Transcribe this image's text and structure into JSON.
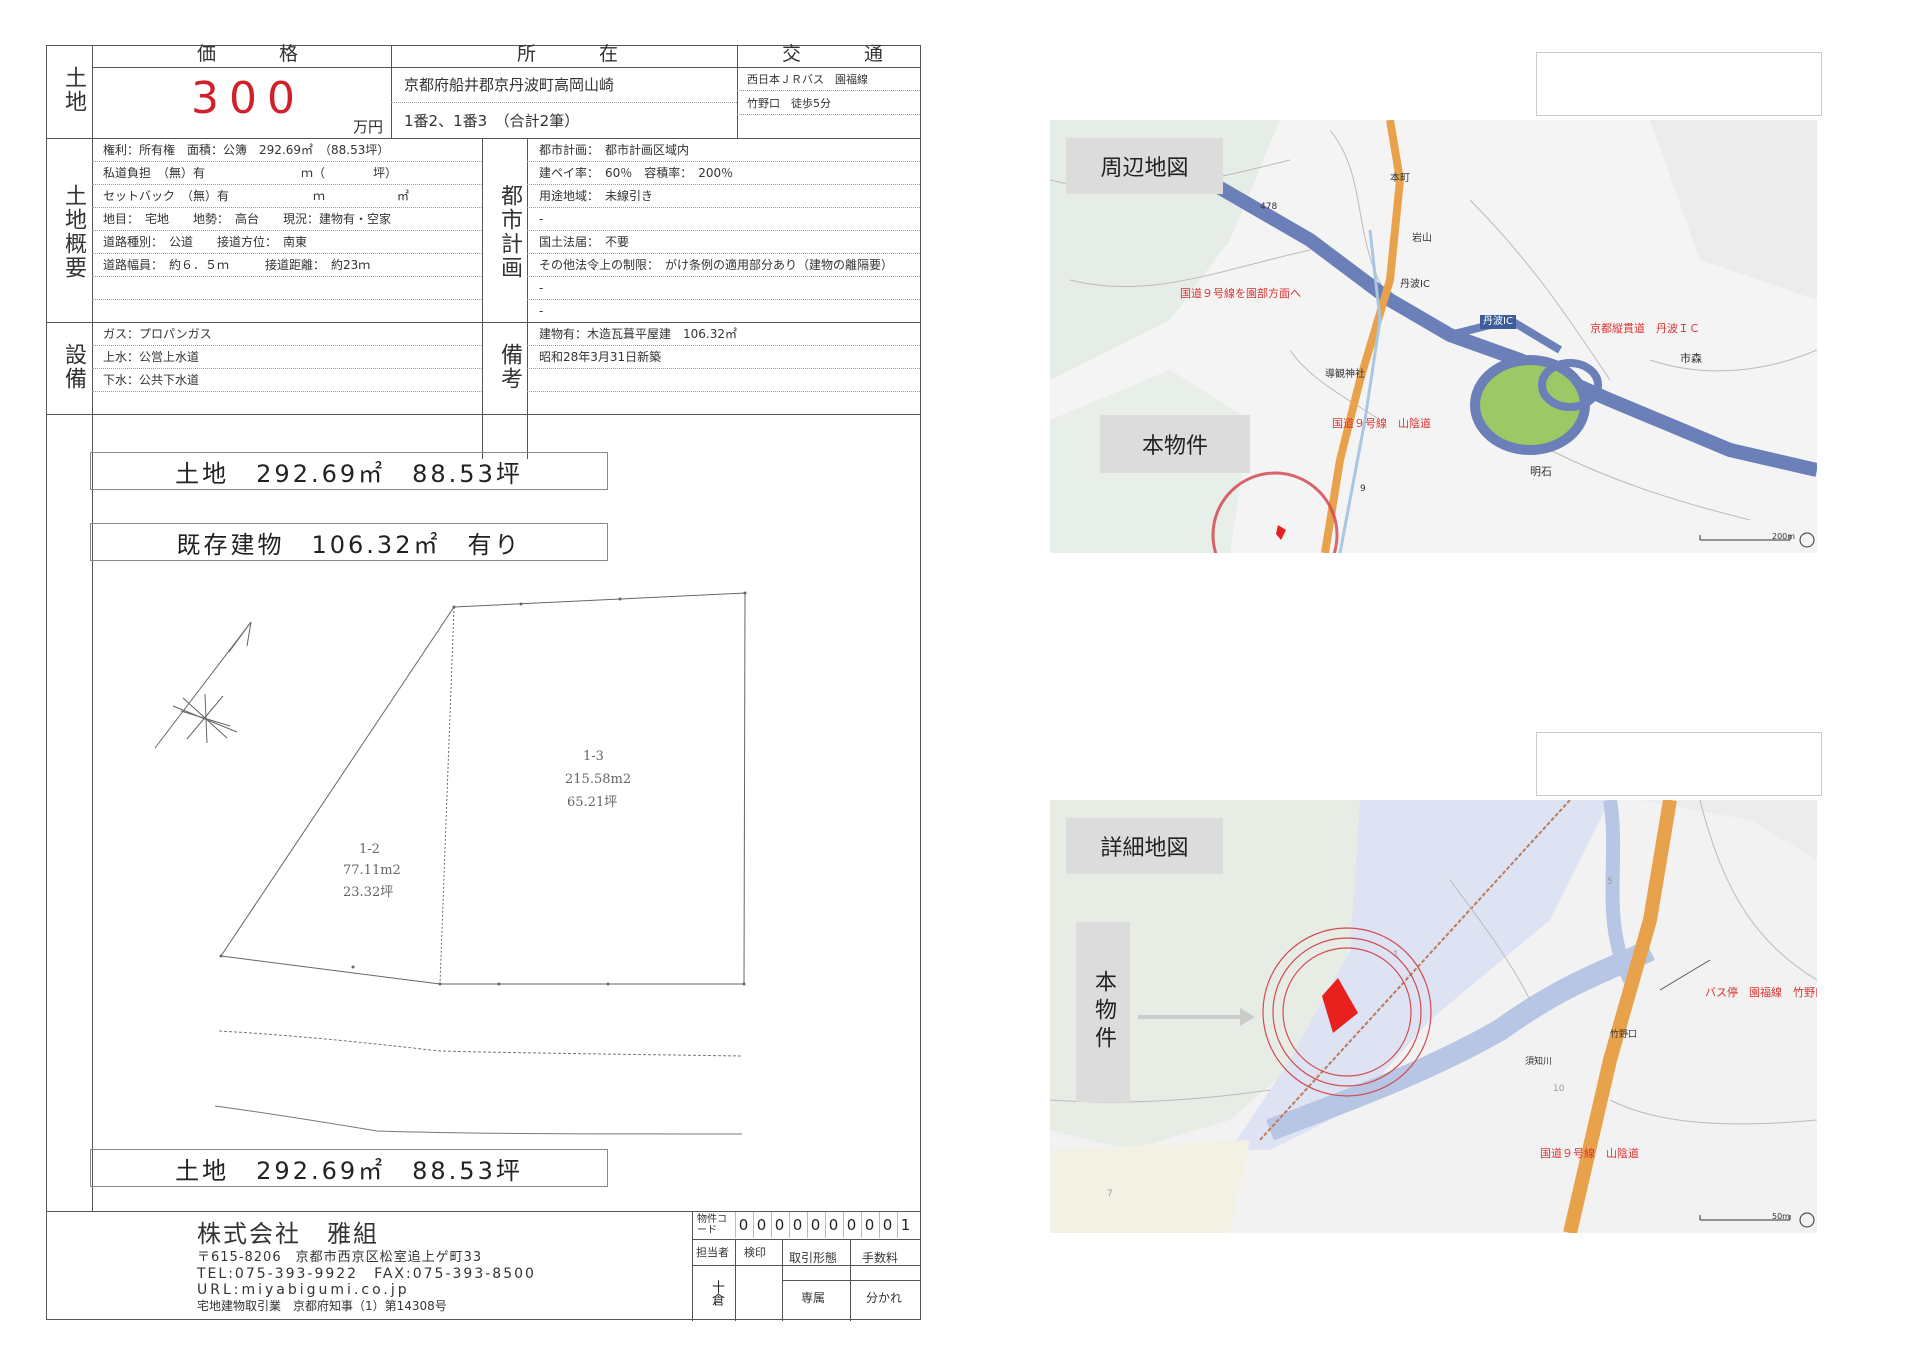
{
  "header": {
    "category_label": "土地",
    "price_header": "価　格",
    "location_header": "所　在",
    "transport_header": "交　通",
    "price_value": "300",
    "price_unit": "万円",
    "address_line1": "京都府船井郡京丹波町高岡山崎",
    "address_line2": "1番2、1番3　（合計2筆）",
    "transport_line1": "西日本ＪＲバス　園福線",
    "transport_line2": "竹野口　徒歩5分"
  },
  "land_overview": {
    "section_label": "土地概要",
    "rows": [
      "権利：所有権　面積：公簿　292.69㎡　（88.53坪）",
      "私道負担　（無）有　　　　　　　　ｍ（　　　　坪）",
      "セットバック　（無）有　　　　　　　ｍ　　　　　　㎡",
      "地目：　宅地　　地勢：　高台　　現況：建物有・空家",
      "道路種別：　公道　　接道方位：　南東",
      "道路幅員：　約６．５ｍ　　　接道距離：　約23ｍ"
    ]
  },
  "city_planning": {
    "section_label": "都市計画",
    "rows": [
      "都市計画：　都市計画区域内",
      "建ペイ率：　60％　容積率：　200％",
      "用途地域：　未線引き",
      "-",
      "国土法届：　不要",
      "その他法令上の制限：　がけ条例の適用部分あり（建物の離隔要）",
      "-",
      "-"
    ]
  },
  "facilities": {
    "section_label": "設備",
    "rows": [
      "ガス：プロパンガス",
      "上水：公営上水道",
      "下水：公共下水道"
    ]
  },
  "remarks": {
    "section_label": "備考",
    "rows": [
      "建物有：木造瓦葺平屋建　106.32㎡",
      "昭和28年3月31日新築"
    ]
  },
  "summary": {
    "land_area": "土地　292.69㎡　88.53坪",
    "existing_building": "既存建物　106.32㎡　有り",
    "land_area_bottom": "土地　292.69㎡　88.53坪"
  },
  "plot": {
    "lot_a": {
      "id": "1-2",
      "area_m2": "77.11m2",
      "area_tsubo": "23.32坪"
    },
    "lot_b": {
      "id": "1-3",
      "area_m2": "215.58m2",
      "area_tsubo": "65.21坪"
    }
  },
  "company": {
    "name": "株式会社　雅組",
    "postal_address": "〒615-8206　京都市西京区松室追上ゲ町33",
    "phone_fax": "TEL:075-393-9922　FAX:075-393-8500",
    "url": "URL:miyabigumi.co.jp",
    "license": "宅地建物取引業　京都府知事（1）第14308号"
  },
  "footer_table": {
    "property_code_label": "物件コード",
    "property_code": [
      "0",
      "0",
      "0",
      "0",
      "0",
      "0",
      "0",
      "0",
      "0",
      "1"
    ],
    "staff_label": "担当者",
    "stamp_label": "検印",
    "transaction_label": "取引形態",
    "fee_label": "手数料",
    "staff_name": "十倉",
    "transaction_value": "専属",
    "fee_value": "分かれ"
  },
  "map_area": {
    "title": "周辺地図",
    "property_label": "本物件",
    "labels": {
      "route9_to_sonobe": "国道９号線を園部方面へ",
      "kyoto_jukan": "京都縦貫道　丹波ＩＣ",
      "route9_sanin": "国道９号線　山陰道",
      "ichimori": "市森",
      "akashi": "明石",
      "tamba_ic": "丹波IC",
      "tamba_ic2": "丹波IC",
      "motomachi": "本町",
      "iwayama": "岩山",
      "shrine": "導観神社",
      "route_num": "478",
      "route9": "9",
      "scale": "200m"
    }
  },
  "detail_map": {
    "title": "詳細地図",
    "property_label": "本物件",
    "labels": {
      "bus_stop": "バス停　園福線　竹野口",
      "route9_sanin": "国道９号線　山陰道",
      "river": "須知川",
      "takenoguchi": "竹野口",
      "num5": "5",
      "num10": "10",
      "num7": "7",
      "num1": "1",
      "scale": "50m"
    }
  },
  "colors": {
    "price_red": "#d0202a",
    "property_marker": "#e8201e",
    "highway_blue": "#6b7fb8",
    "national_route_orange": "#e8a24c",
    "circle_red": "#d34a52"
  }
}
